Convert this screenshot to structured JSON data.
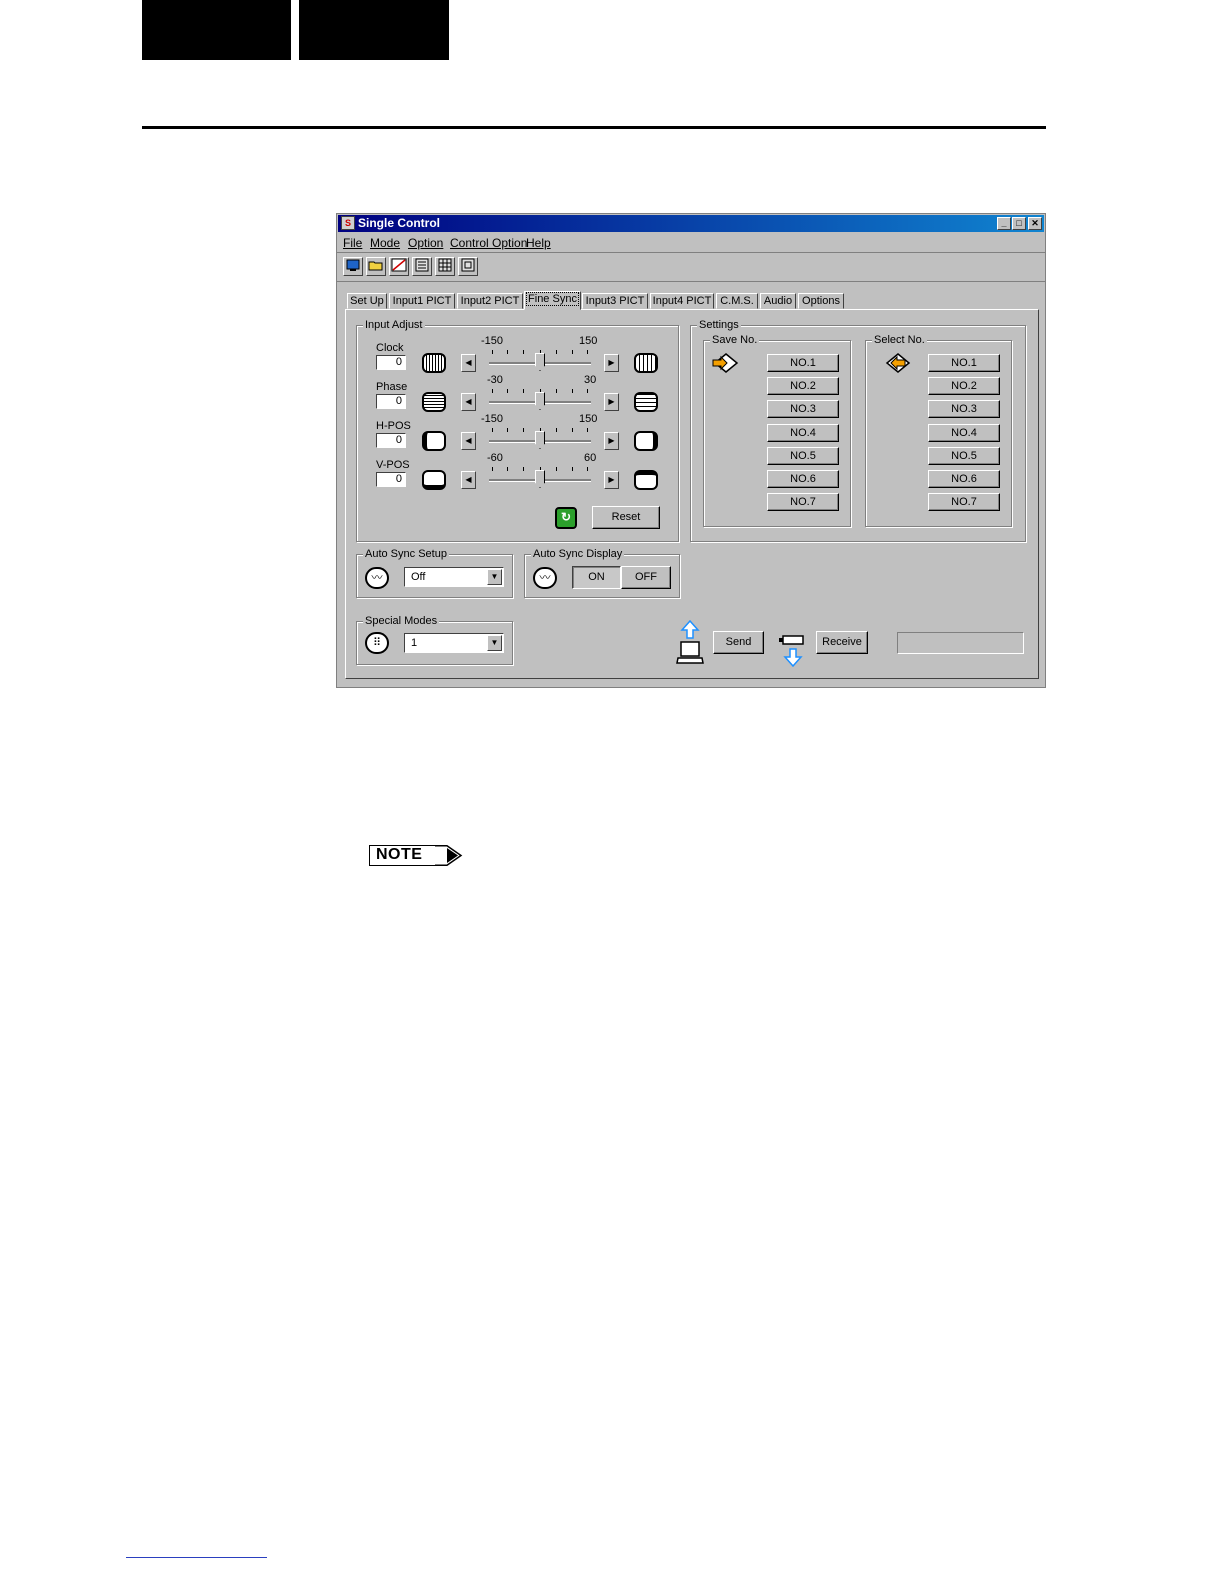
{
  "window": {
    "title": "Single Control",
    "title_icon": "S",
    "controls": {
      "minimize": "_",
      "maximize": "□",
      "close": "✕"
    }
  },
  "menu": [
    {
      "label": "File"
    },
    {
      "label": "Mode"
    },
    {
      "label": "Option"
    },
    {
      "label": "Control Option"
    },
    {
      "label": "Help"
    }
  ],
  "toolbar_icons": [
    "monitor-icon",
    "open-folder-icon",
    "graph-icon",
    "panel-icon",
    "grid-icon",
    "layout-icon"
  ],
  "tabs": [
    {
      "label": "Set Up"
    },
    {
      "label": "Input1 PICT"
    },
    {
      "label": "Input2 PICT"
    },
    {
      "label": "Fine Sync",
      "active": true
    },
    {
      "label": "Input3 PICT"
    },
    {
      "label": "Input4 PICT"
    },
    {
      "label": "C.M.S."
    },
    {
      "label": "Audio"
    },
    {
      "label": "Options"
    }
  ],
  "input_adjust": {
    "legend": "Input Adjust",
    "rows": [
      {
        "label": "Clock",
        "value": "0",
        "min": "-150",
        "max": "150",
        "pos": 0.5
      },
      {
        "label": "Phase",
        "value": "0",
        "min": "-30",
        "max": "30",
        "pos": 0.5
      },
      {
        "label": "H-POS",
        "value": "0",
        "min": "-150",
        "max": "150",
        "pos": 0.5
      },
      {
        "label": "V-POS",
        "value": "0",
        "min": "-60",
        "max": "60",
        "pos": 0.5
      }
    ],
    "reset_label": "Reset"
  },
  "settings": {
    "legend": "Settings",
    "save": {
      "legend": "Save No.",
      "items": [
        "NO.1",
        "NO.2",
        "NO.3",
        "NO.4",
        "NO.5",
        "NO.6",
        "NO.7"
      ]
    },
    "select": {
      "legend": "Select No.",
      "items": [
        "NO.1",
        "NO.2",
        "NO.3",
        "NO.4",
        "NO.5",
        "NO.6",
        "NO.7"
      ]
    }
  },
  "auto_sync_setup": {
    "legend": "Auto Sync Setup",
    "selected": "Off"
  },
  "auto_sync_display": {
    "legend": "Auto Sync Display",
    "on_label": "ON",
    "off_label": "OFF",
    "active": "ON"
  },
  "special_modes": {
    "legend": "Special Modes",
    "selected": "1"
  },
  "transfer": {
    "send_label": "Send",
    "receive_label": "Receive"
  },
  "note_label": "NOTE",
  "colors": {
    "titlebar_start": "#000080",
    "titlebar_end": "#1084d0",
    "face": "#c0c0c0",
    "arrow_orange": "#f5a000",
    "arrow_blue": "#1e90ff"
  }
}
